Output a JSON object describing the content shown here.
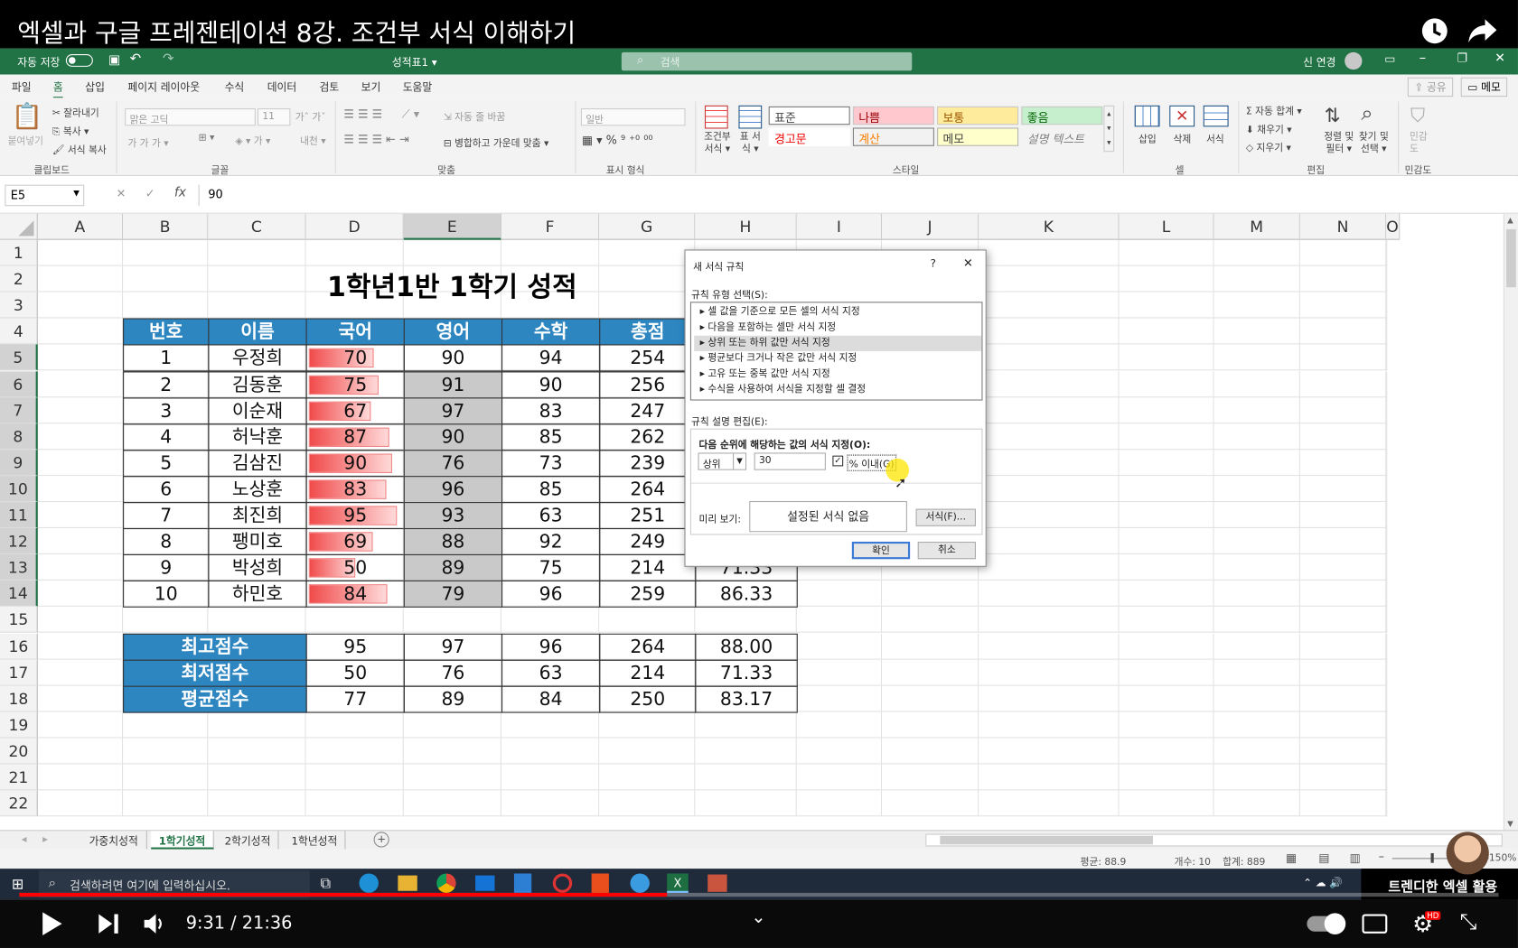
{
  "video": {
    "title": "엑셀과 구글 프레젠테이션 8강. 조건부 서식 이해하기",
    "time_current": "9:31",
    "time_sep": " / ",
    "time_total": "21:36",
    "progress": 0.4375,
    "channel_badge": "트렌디한 엑셀 활용",
    "hd_badge": "HD"
  },
  "excel_title": {
    "autosave": "자동 저장",
    "file_name": "성적표1 ▾",
    "search": "검색",
    "user": "신 연경"
  },
  "tabs": [
    "파일",
    "홈",
    "삽입",
    "페이지 레이아웃",
    "수식",
    "데이터",
    "검토",
    "보기",
    "도움말"
  ],
  "share": "공유",
  "memo": "메모",
  "ribbon": {
    "clipboard": {
      "paste": "붙여넣기",
      "cut": "잘라내기",
      "copy": "복사 ▾",
      "format": "서식 복사",
      "group": "클립보드"
    },
    "font": {
      "name": "맑은 고딕",
      "size": "11",
      "group": "글꼴"
    },
    "align": {
      "wrap": "자동 줄 바꿈",
      "merge": "병합하고 가운데 맞춤 ▾",
      "group": "맞춤"
    },
    "number": {
      "format": "일반",
      "group": "표시 형식"
    },
    "styles": {
      "cond": "조건부 서식 ▾",
      "table": "표 서식 ▾",
      "normal": "표준",
      "bad": "나쁨",
      "neutral": "보통",
      "good": "좋음",
      "warning": "경고문",
      "calc": "계산",
      "note": "메모",
      "explain": "설명 텍스트",
      "group": "스타일"
    },
    "cells": {
      "insert": "삽입",
      "delete": "삭제",
      "format": "서식",
      "group": "셀"
    },
    "edit": {
      "autosum": "자동 합계 ▾",
      "fill": "채우기 ▾",
      "clear": "지우기 ▾",
      "sort": "정렬 및 필터 ▾",
      "find": "찾기 및 선택 ▾",
      "group": "편집"
    },
    "sens": {
      "label": "민감도",
      "group": "민감도"
    }
  },
  "formula": {
    "namebox": "E5",
    "fx": "fx",
    "value": "90"
  },
  "columns": [
    "A",
    "B",
    "C",
    "D",
    "E",
    "F",
    "G",
    "H",
    "I",
    "J",
    "K",
    "L",
    "M",
    "N",
    "O"
  ],
  "rows": [
    "1",
    "2",
    "3",
    "4",
    "5",
    "6",
    "7",
    "8",
    "9",
    "10",
    "11",
    "12",
    "13",
    "14",
    "15",
    "16",
    "17",
    "18",
    "19",
    "20",
    "21",
    "22"
  ],
  "sheet": {
    "title": "1학년1반 1학기 성적",
    "headers": [
      "번호",
      "이름",
      "국어",
      "영어",
      "수학",
      "총점"
    ],
    "data": [
      [
        "1",
        "우정희",
        "70",
        "90",
        "94",
        "254"
      ],
      [
        "2",
        "김동훈",
        "75",
        "91",
        "90",
        "256"
      ],
      [
        "3",
        "이순재",
        "67",
        "97",
        "83",
        "247"
      ],
      [
        "4",
        "허낙훈",
        "87",
        "90",
        "85",
        "262"
      ],
      [
        "5",
        "김삼진",
        "90",
        "76",
        "73",
        "239"
      ],
      [
        "6",
        "노상훈",
        "83",
        "96",
        "85",
        "264"
      ],
      [
        "7",
        "최진희",
        "95",
        "93",
        "63",
        "251"
      ],
      [
        "8",
        "팽미호",
        "69",
        "88",
        "92",
        "249"
      ],
      [
        "9",
        "박성희",
        "50",
        "89",
        "75",
        "214"
      ],
      [
        "10",
        "하민호",
        "84",
        "79",
        "96",
        "259"
      ]
    ],
    "h_values": {
      "row13": "71.33",
      "row14": "86.33"
    },
    "summary": [
      {
        "label": "최고점수",
        "values": [
          "95",
          "97",
          "96",
          "264",
          "88.00"
        ]
      },
      {
        "label": "최저점수",
        "values": [
          "50",
          "76",
          "63",
          "214",
          "71.33"
        ]
      },
      {
        "label": "평균점수",
        "values": [
          "77",
          "89",
          "84",
          "250",
          "83.17"
        ]
      }
    ]
  },
  "dialog": {
    "title": "새 서식 규칙",
    "help": "?",
    "close": "✕",
    "rule_type_label": "규칙 유형 선택(S):",
    "rule_types": [
      "▸ 셀 값을 기준으로 모든 셀의 서식 지정",
      "▸ 다음을 포함하는 셀만 서식 지정",
      "▸ 상위 또는 하위 값만 서식 지정",
      "▸ 평균보다 크거나 작은 값만 서식 지정",
      "▸ 고유 또는 중복 값만 서식 지정",
      "▸ 수식을 사용하여 서식을 지정할 셀 결정"
    ],
    "desc_label": "규칙 설명 편집(E):",
    "desc_heading": "다음 순위에 해당하는 값의 서식 지정(O):",
    "rank_select": "상위",
    "rank_value": "30",
    "percent_label": "% 이내(G)",
    "preview_label": "미리 보기:",
    "preview_text": "설정된 서식 없음",
    "format_btn": "서식(F)...",
    "ok": "확인",
    "cancel": "취소"
  },
  "sheet_tabs": [
    "가중치성적",
    "1학기성적",
    "2학기성적",
    "1학년성적"
  ],
  "status": {
    "avg": "평균: 88.9",
    "count": "개수: 10",
    "sum": "합계: 889",
    "zoom": "150%"
  },
  "taskbar": {
    "search": "검색하려면 여기에 입력하십시오."
  }
}
